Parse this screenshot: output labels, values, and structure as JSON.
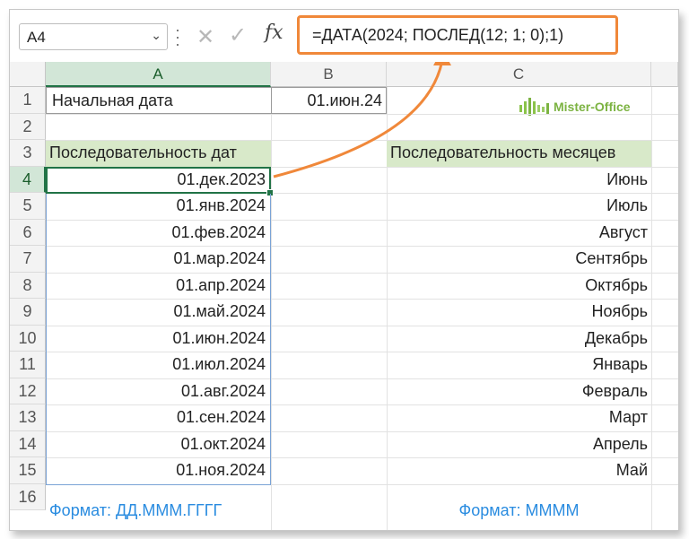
{
  "name_box": {
    "value": "A4"
  },
  "formula_bar": {
    "cancel_glyph": "✕",
    "enter_glyph": "✓",
    "fx_label": "fx",
    "formula": "=ДАТА(2024; ПОСЛЕД(12; 1; 0);1)"
  },
  "columns": [
    "A",
    "B",
    "C"
  ],
  "rows": [
    "1",
    "2",
    "3",
    "4",
    "5",
    "6",
    "7",
    "8",
    "9",
    "10",
    "11",
    "12",
    "13",
    "14",
    "15",
    "16"
  ],
  "cells": {
    "a1": "Начальная дата",
    "b1": "01.июн.24",
    "a3": "Последовательность дат",
    "c3": "Последовательность месяцев",
    "a16": "Формат: ДД.МММ.ГГГГ",
    "c16": "Формат: ММММ"
  },
  "dates": [
    "01.дек.2023",
    "01.янв.2024",
    "01.фев.2024",
    "01.мар.2024",
    "01.апр.2024",
    "01.май.2024",
    "01.июн.2024",
    "01.июл.2024",
    "01.авг.2024",
    "01.сен.2024",
    "01.окт.2024",
    "01.ноя.2024"
  ],
  "months": [
    "Июнь",
    "Июль",
    "Август",
    "Сентябрь",
    "Октябрь",
    "Ноябрь",
    "Декабрь",
    "Январь",
    "Февраль",
    "Март",
    "Апрель",
    "Май"
  ],
  "logo": {
    "text": "Mister-Office"
  },
  "colors": {
    "accent": "#f0883a",
    "header_fill": "#d8e9c9",
    "selection": "#217346",
    "note_blue": "#2a8ce0"
  }
}
